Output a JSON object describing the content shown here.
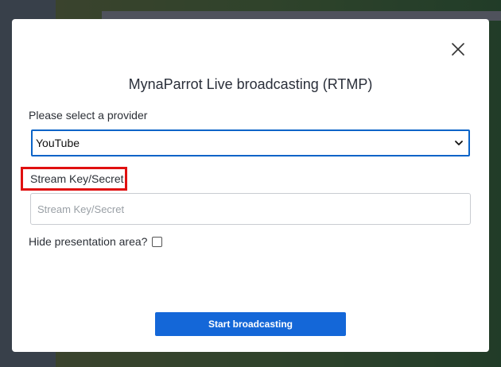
{
  "modal": {
    "title": "MynaParrot Live broadcasting (RTMP)",
    "close_icon": "close-icon",
    "provider_label": "Please select a provider",
    "provider_selected": "YouTube",
    "stream_key_label": "Stream Key/Secret",
    "stream_key_placeholder": "Stream Key/Secret",
    "stream_key_value": "",
    "hide_presentation_label": "Hide presentation area?",
    "hide_presentation_checked": false,
    "start_button_label": "Start broadcasting"
  },
  "colors": {
    "primary": "#1467d8",
    "select_border": "#0a64c8",
    "highlight": "#e01010"
  }
}
